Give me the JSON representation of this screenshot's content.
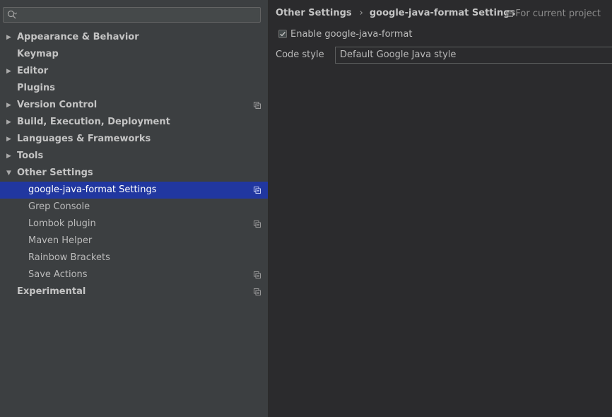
{
  "search": {
    "placeholder": "",
    "value": ""
  },
  "tree": [
    {
      "label": "Appearance & Behavior",
      "level": 0,
      "arrow": "collapsed",
      "bold": true,
      "project": false,
      "selected": false
    },
    {
      "label": "Keymap",
      "level": 0,
      "arrow": "none",
      "bold": true,
      "project": false,
      "selected": false
    },
    {
      "label": "Editor",
      "level": 0,
      "arrow": "collapsed",
      "bold": true,
      "project": false,
      "selected": false
    },
    {
      "label": "Plugins",
      "level": 0,
      "arrow": "none",
      "bold": true,
      "project": false,
      "selected": false
    },
    {
      "label": "Version Control",
      "level": 0,
      "arrow": "collapsed",
      "bold": true,
      "project": true,
      "selected": false
    },
    {
      "label": "Build, Execution, Deployment",
      "level": 0,
      "arrow": "collapsed",
      "bold": true,
      "project": false,
      "selected": false
    },
    {
      "label": "Languages & Frameworks",
      "level": 0,
      "arrow": "collapsed",
      "bold": true,
      "project": false,
      "selected": false
    },
    {
      "label": "Tools",
      "level": 0,
      "arrow": "collapsed",
      "bold": true,
      "project": false,
      "selected": false
    },
    {
      "label": "Other Settings",
      "level": 0,
      "arrow": "expanded",
      "bold": true,
      "project": false,
      "selected": false
    },
    {
      "label": "google-java-format Settings",
      "level": 1,
      "arrow": "none",
      "bold": false,
      "project": true,
      "selected": true
    },
    {
      "label": "Grep Console",
      "level": 1,
      "arrow": "none",
      "bold": false,
      "project": false,
      "selected": false
    },
    {
      "label": "Lombok plugin",
      "level": 1,
      "arrow": "none",
      "bold": false,
      "project": true,
      "selected": false
    },
    {
      "label": "Maven Helper",
      "level": 1,
      "arrow": "none",
      "bold": false,
      "project": false,
      "selected": false
    },
    {
      "label": "Rainbow Brackets",
      "level": 1,
      "arrow": "none",
      "bold": false,
      "project": false,
      "selected": false
    },
    {
      "label": "Save Actions",
      "level": 1,
      "arrow": "none",
      "bold": false,
      "project": true,
      "selected": false
    },
    {
      "label": "Experimental",
      "level": 0,
      "arrow": "none",
      "bold": true,
      "project": true,
      "selected": false
    }
  ],
  "breadcrumb": {
    "parent": "Other Settings",
    "separator": "›",
    "current": "google-java-format Settings"
  },
  "scope_note": "For current project",
  "settings": {
    "enable_label": "Enable google-java-format",
    "enable_checked": true,
    "code_style_label": "Code style",
    "code_style_value": "Default Google Java style"
  },
  "colors": {
    "selection": "#2137a0",
    "sidebar_bg": "#3c3f41",
    "content_bg": "#2b2b2d"
  }
}
